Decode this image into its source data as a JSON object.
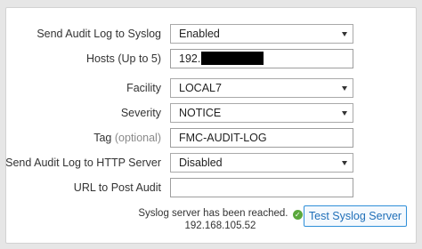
{
  "form": {
    "syslog_enable": {
      "label": "Send Audit Log to Syslog",
      "value": "Enabled"
    },
    "hosts": {
      "label": "Hosts (Up to 5)",
      "value": "192."
    },
    "facility": {
      "label": "Facility",
      "value": "LOCAL7"
    },
    "severity": {
      "label": "Severity",
      "value": "NOTICE"
    },
    "tag": {
      "label": "Tag",
      "optional_note": "(optional)",
      "value": "FMC-AUDIT-LOG"
    },
    "http_enable": {
      "label": "Send Audit Log to HTTP Server",
      "value": "Disabled"
    },
    "url": {
      "label": "URL to Post Audit",
      "value": ""
    }
  },
  "status": {
    "message": "Syslog server has been reached.",
    "address": "192.168.105.52",
    "ok_icon": "check-circle-icon",
    "ok_color": "#5aa83c"
  },
  "actions": {
    "test_syslog_label": "Test Syslog Server",
    "accent_color": "#2f8fd8"
  }
}
